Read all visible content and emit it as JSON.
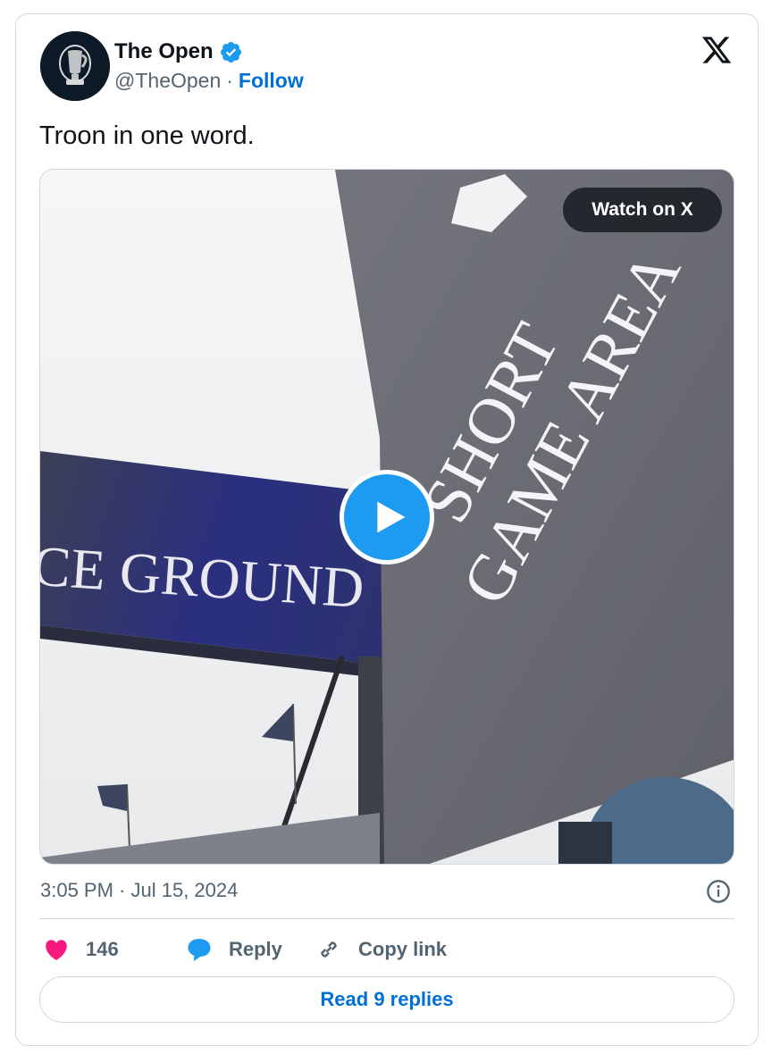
{
  "tweet": {
    "author_name": "The Open",
    "author_handle": "@TheOpen",
    "separator": "·",
    "follow_label": "Follow",
    "text": "Troon in one word.",
    "timestamp": "3:05 PM · Jul 15, 2024"
  },
  "media": {
    "watch_label": "Watch on X",
    "sign_left_text": "CE GROUND",
    "sign_right_line1": "SHORT",
    "sign_right_line2": "GAME AREA"
  },
  "actions": {
    "like_count": "146",
    "reply_label": "Reply",
    "copy_label": "Copy link"
  },
  "footer": {
    "read_replies_label": "Read 9 replies"
  },
  "colors": {
    "accent": "#1d9bf0",
    "link": "#006fd6",
    "like": "#f91880",
    "muted": "#536471"
  },
  "icons": {
    "avatar": "claret-jug-logo",
    "verified": "verified-badge-icon",
    "brand": "x-logo-icon",
    "play": "play-icon",
    "info": "info-icon",
    "like": "heart-icon",
    "reply": "speech-bubble-icon",
    "copy": "link-icon"
  }
}
